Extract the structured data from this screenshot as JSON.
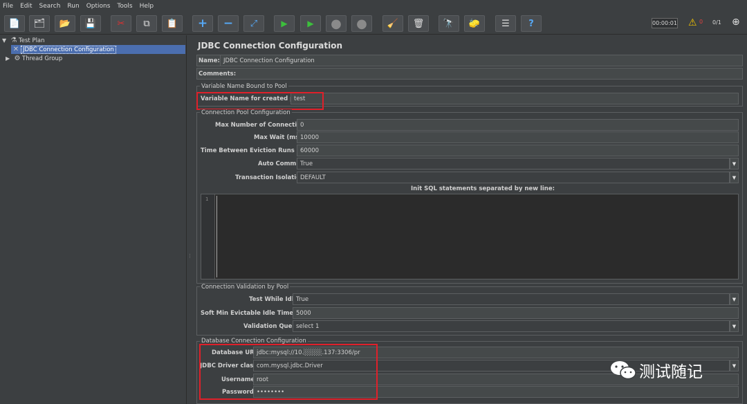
{
  "menu": [
    "File",
    "Edit",
    "Search",
    "Run",
    "Options",
    "Tools",
    "Help"
  ],
  "toolbar": {
    "buttons": [
      {
        "name": "new-icon",
        "glyph": "📄"
      },
      {
        "name": "templates-icon",
        "glyph": "🗂"
      },
      {
        "name": "open-icon",
        "glyph": "📂"
      },
      {
        "name": "save-icon",
        "glyph": "💾"
      },
      {
        "name": "cut-icon",
        "glyph": "✂"
      },
      {
        "name": "copy-icon",
        "glyph": "⧉"
      },
      {
        "name": "paste-icon",
        "glyph": "📋"
      },
      {
        "name": "expand-icon",
        "glyph": "+"
      },
      {
        "name": "collapse-icon",
        "glyph": "−"
      },
      {
        "name": "toggle-icon",
        "glyph": "⤢"
      },
      {
        "name": "start-icon",
        "glyph": "▶"
      },
      {
        "name": "start-no-pause-icon",
        "glyph": "▶"
      },
      {
        "name": "stop-icon",
        "glyph": "●"
      },
      {
        "name": "shutdown-icon",
        "glyph": "●"
      },
      {
        "name": "clear-icon",
        "glyph": "🧹"
      },
      {
        "name": "clear-all-icon",
        "glyph": "🗑"
      },
      {
        "name": "search-icon",
        "glyph": "🔭"
      },
      {
        "name": "reset-search-icon",
        "glyph": "🧽"
      },
      {
        "name": "function-helper-icon",
        "glyph": "☰"
      },
      {
        "name": "help-icon",
        "glyph": "?"
      }
    ],
    "timer": "00:00:01",
    "warnings": "0",
    "threads": "0/1"
  },
  "tree": {
    "items": [
      {
        "label": "Test Plan",
        "icon": "flask-icon"
      },
      {
        "label": "JDBC Connection Configuration",
        "icon": "wrench-icon"
      },
      {
        "label": "Thread Group",
        "icon": "gear-icon"
      }
    ]
  },
  "editor": {
    "title": "JDBC Connection Configuration",
    "name_label": "Name:",
    "name_value": "JDBC Connection Configuration",
    "comments_label": "Comments:",
    "var_group": "Variable Name Bound to Pool",
    "var_label": "Variable Name for created pool:",
    "var_value": "test",
    "pool_group": "Connection Pool Configuration",
    "max_conn_label": "Max Number of Connections:",
    "max_conn_value": "0",
    "max_wait_label": "Max Wait (ms):",
    "max_wait_value": "10000",
    "evict_label": "Time Between Eviction Runs (ms):",
    "evict_value": "60000",
    "autocommit_label": "Auto Commit:",
    "autocommit_value": "True",
    "isolation_label": "Transaction Isolation:",
    "isolation_value": "DEFAULT",
    "init_sql_label": "Init SQL statements separated by new line:",
    "init_sql_line": "1",
    "validation_group": "Connection Validation by Pool",
    "test_idle_label": "Test While Idle:",
    "test_idle_value": "True",
    "soft_min_label": "Soft Min Evictable Idle Time(ms):",
    "soft_min_value": "5000",
    "validation_query_label": "Validation Query:",
    "validation_query_value": "select 1",
    "db_group": "Database Connection Configuration",
    "db_url_label": "Database URL:",
    "db_url_value": "jdbc:mysql://10.░░░░.137:3306/pr",
    "driver_label": "JDBC Driver class:",
    "driver_value": "com.mysql.jdbc.Driver",
    "username_label": "Username:",
    "username_value": "root",
    "password_label": "Password:",
    "password_value": "••••••••"
  },
  "watermark": "测试随记"
}
